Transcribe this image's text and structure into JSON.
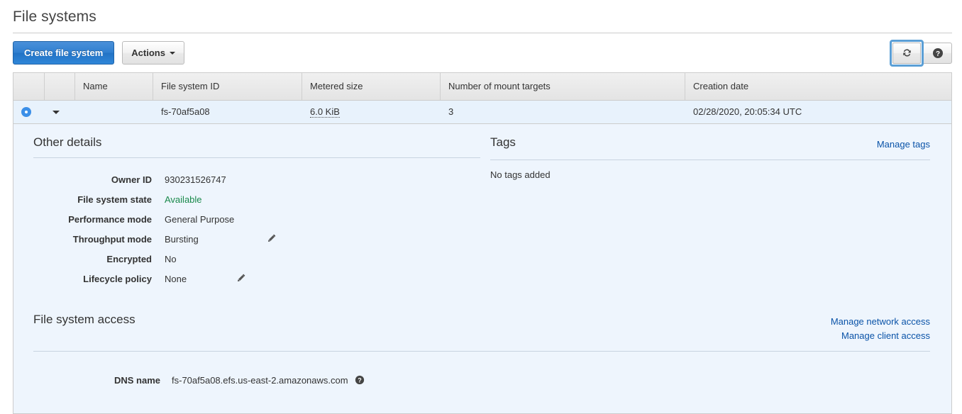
{
  "page": {
    "title": "File systems"
  },
  "toolbar": {
    "create_label": "Create file system",
    "actions_label": "Actions",
    "refresh_icon": "refresh-icon",
    "help_icon": "help-icon"
  },
  "table": {
    "columns": [
      "",
      "",
      "Name",
      "File system ID",
      "Metered size",
      "Number of mount targets",
      "Creation date"
    ],
    "rows": [
      {
        "selected": true,
        "name": "",
        "file_system_id": "fs-70af5a08",
        "metered_size": "6.0 KiB",
        "mount_targets": "3",
        "creation_date": "02/28/2020, 20:05:34 UTC"
      }
    ]
  },
  "detail": {
    "other_details": {
      "title": "Other details",
      "items": [
        {
          "label": "Owner ID",
          "value": "930231526747",
          "editable": false,
          "state": false
        },
        {
          "label": "File system state",
          "value": "Available",
          "editable": false,
          "state": true
        },
        {
          "label": "Performance mode",
          "value": "General Purpose",
          "editable": false,
          "state": false
        },
        {
          "label": "Throughput mode",
          "value": "Bursting",
          "editable": true,
          "state": false
        },
        {
          "label": "Encrypted",
          "value": "No",
          "editable": false,
          "state": false
        },
        {
          "label": "Lifecycle policy",
          "value": "None",
          "editable": true,
          "state": false
        }
      ]
    },
    "tags": {
      "title": "Tags",
      "manage_link": "Manage tags",
      "empty_text": "No tags added"
    },
    "access": {
      "title": "File system access",
      "links": [
        "Manage network access",
        "Manage client access"
      ],
      "dns_label": "DNS name",
      "dns_value": "fs-70af5a08.efs.us-east-2.amazonaws.com"
    }
  },
  "colors": {
    "primary_button": "#2d7dd2",
    "link": "#0a53a8",
    "state_available": "#19894b",
    "row_selected": "#e8f2fc",
    "detail_panel": "#eef5fd"
  }
}
